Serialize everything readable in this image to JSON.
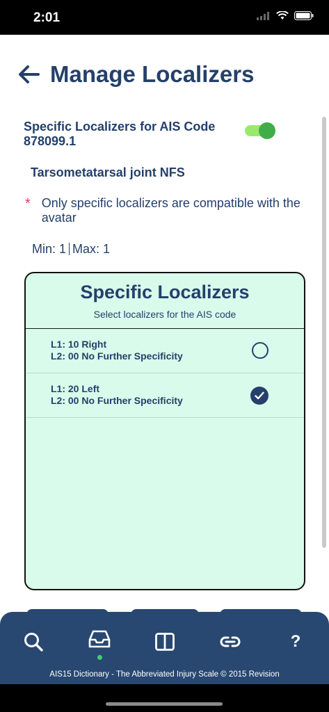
{
  "status": {
    "time": "2:01"
  },
  "header": {
    "title": "Manage Localizers"
  },
  "toggle": {
    "label": "Specific Localizers for AIS Code 878099.1",
    "on": true
  },
  "description": "Tarsometatarsal joint NFS",
  "note": {
    "asterisk": "*",
    "text": "Only specific localizers are compatible with the avatar"
  },
  "limits": {
    "min": "Min: 1",
    "max": "Max: 1"
  },
  "panel": {
    "title": "Specific Localizers",
    "subtitle": "Select localizers for the AIS code",
    "items": [
      {
        "l1": "L1: 10 Right",
        "l2": "L2: 00 No Further Specificity",
        "selected": false
      },
      {
        "l1": "L1: 20 Left",
        "l2": "L2: 00 No Further Specificity",
        "selected": true
      }
    ]
  },
  "tabbar": {
    "tabs": [
      "search-icon",
      "inbox-icon",
      "columns-icon",
      "link-icon",
      "help-icon"
    ],
    "help_glyph": "?",
    "footer": "AIS15 Dictionary - The Abbreviated Injury Scale © 2015 Revision",
    "active_color": "#3fd06b"
  },
  "colors": {
    "primary": "#24406b",
    "panel_bg": "#d8fbeb",
    "toggle_on": "#3fae49",
    "asterisk": "#e23b5b"
  }
}
